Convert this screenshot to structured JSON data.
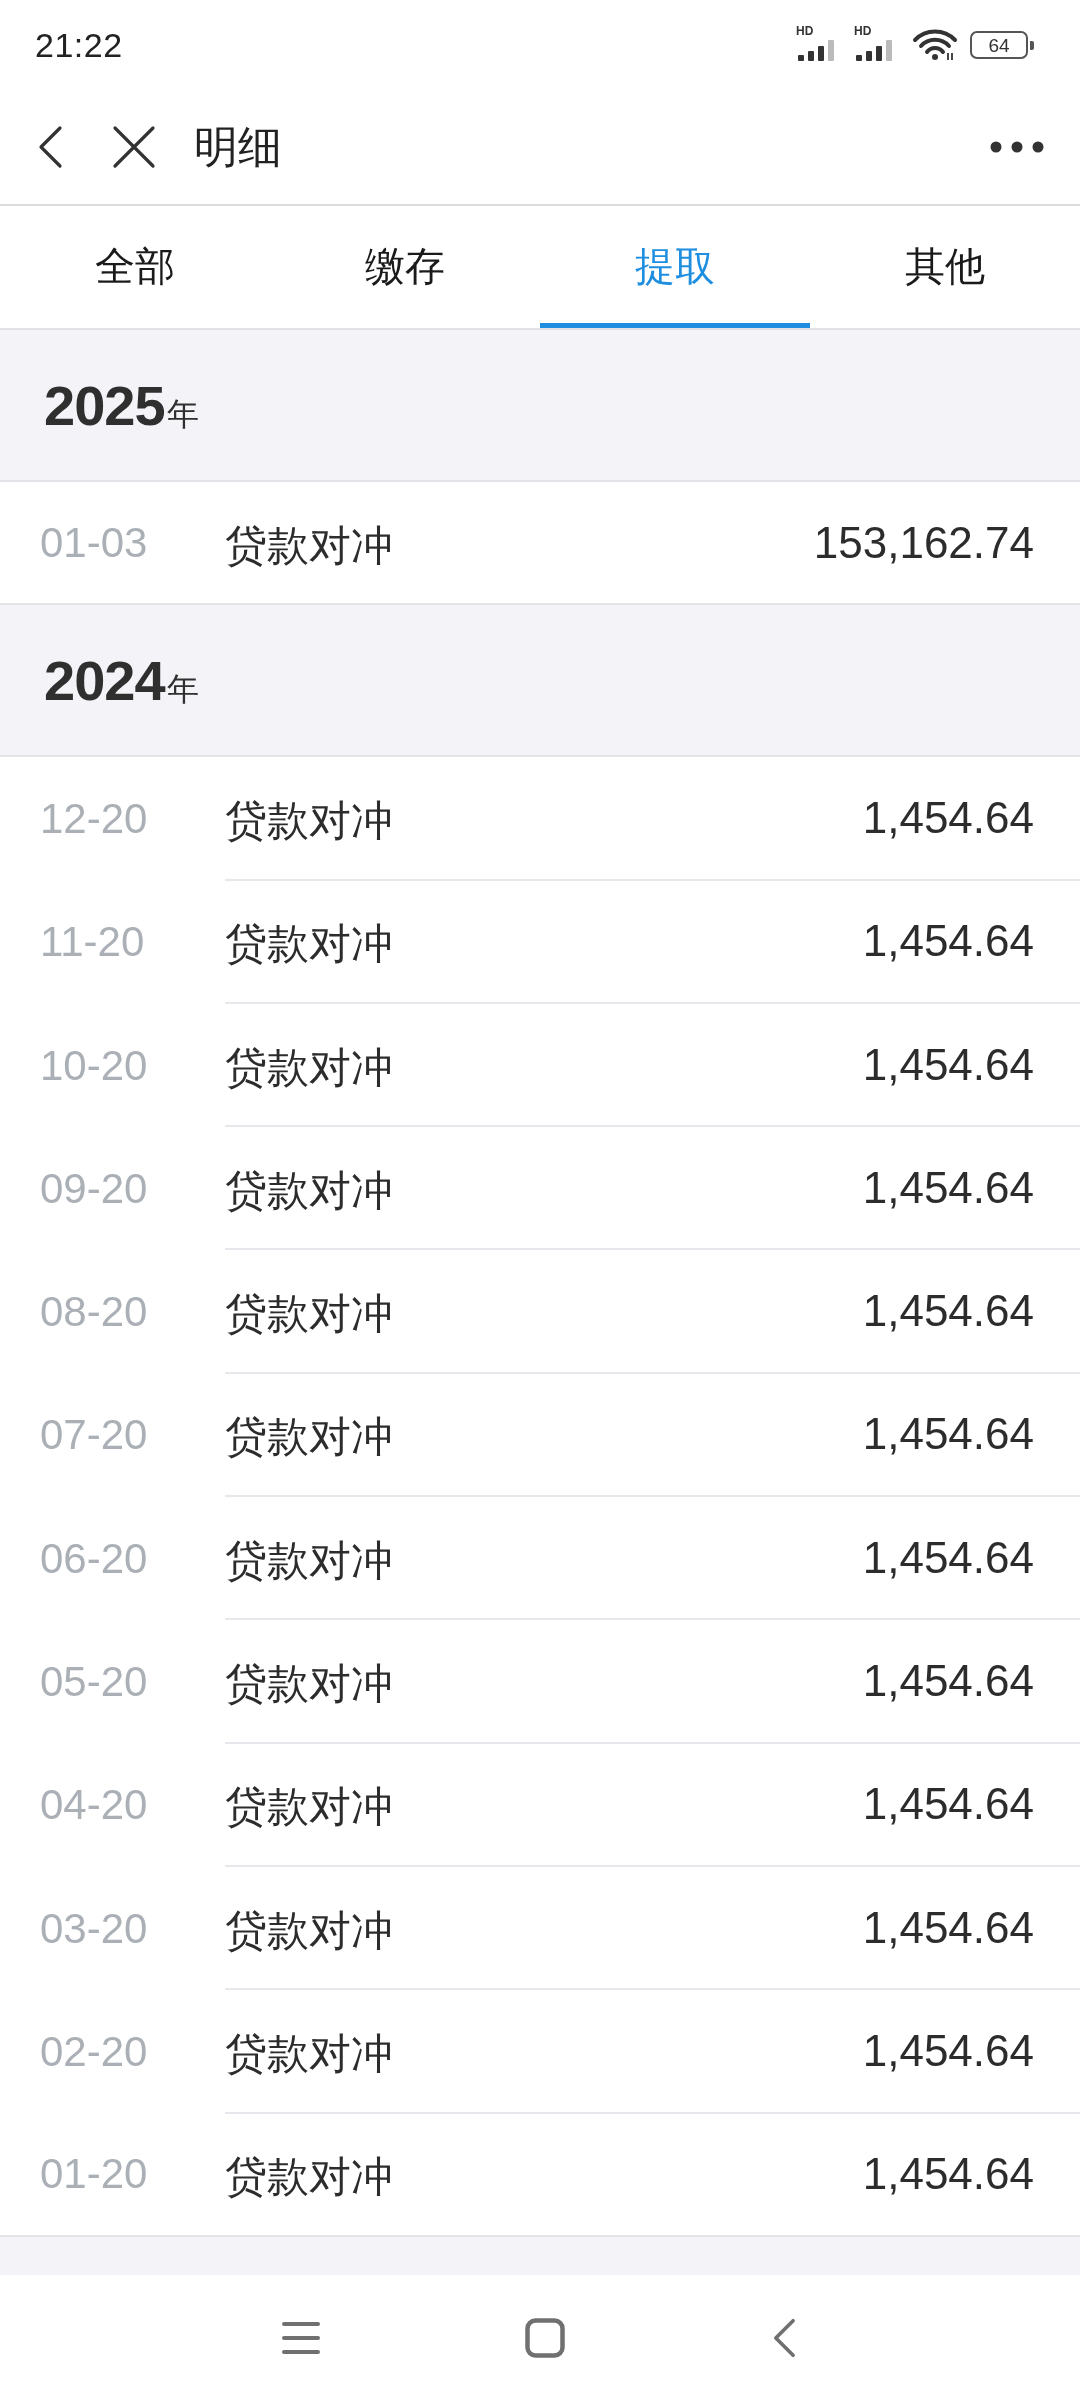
{
  "status_bar": {
    "time": "21:22",
    "signals": [
      {
        "label": "HD"
      },
      {
        "label": "HD"
      }
    ],
    "battery": "64"
  },
  "header": {
    "title": "明细"
  },
  "tabs": [
    {
      "label": "全部",
      "selected": false
    },
    {
      "label": "缴存",
      "selected": false
    },
    {
      "label": "提取",
      "selected": true
    },
    {
      "label": "其他",
      "selected": false
    }
  ],
  "sections": [
    {
      "year": "2025",
      "unit": "年",
      "rows": [
        {
          "date": "01-03",
          "description": "贷款对冲",
          "amount": "153,162.74"
        }
      ]
    },
    {
      "year": "2024",
      "unit": "年",
      "rows": [
        {
          "date": "12-20",
          "description": "贷款对冲",
          "amount": "1,454.64"
        },
        {
          "date": "11-20",
          "description": "贷款对冲",
          "amount": "1,454.64"
        },
        {
          "date": "10-20",
          "description": "贷款对冲",
          "amount": "1,454.64"
        },
        {
          "date": "09-20",
          "description": "贷款对冲",
          "amount": "1,454.64"
        },
        {
          "date": "08-20",
          "description": "贷款对冲",
          "amount": "1,454.64"
        },
        {
          "date": "07-20",
          "description": "贷款对冲",
          "amount": "1,454.64"
        },
        {
          "date": "06-20",
          "description": "贷款对冲",
          "amount": "1,454.64"
        },
        {
          "date": "05-20",
          "description": "贷款对冲",
          "amount": "1,454.64"
        },
        {
          "date": "04-20",
          "description": "贷款对冲",
          "amount": "1,454.64"
        },
        {
          "date": "03-20",
          "description": "贷款对冲",
          "amount": "1,454.64"
        },
        {
          "date": "02-20",
          "description": "贷款对冲",
          "amount": "1,454.64"
        },
        {
          "date": "01-20",
          "description": "贷款对冲",
          "amount": "1,454.64"
        }
      ]
    }
  ]
}
